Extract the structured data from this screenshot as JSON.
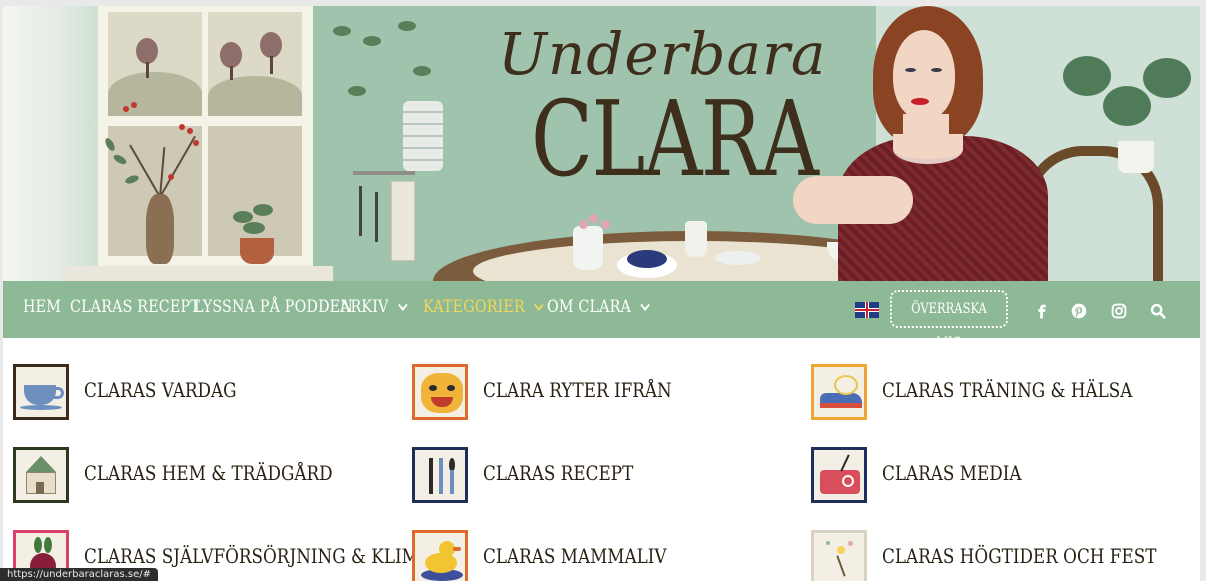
{
  "header": {
    "logo_script": "Underbara",
    "logo_main": "CLARA"
  },
  "nav": {
    "items": [
      {
        "label": "HEM"
      },
      {
        "label": "CLARAS RECEPT"
      },
      {
        "label": "LYSSNA PÅ PODDEN"
      },
      {
        "label": "ARKIV"
      },
      {
        "label": "KATEGORIER"
      },
      {
        "label": "OM CLARA"
      }
    ],
    "surprise_label": "ÖVERRASKA MIG",
    "language_flag": "uk-flag-icon",
    "social_icons": [
      "facebook-icon",
      "pinterest-icon",
      "instagram-icon",
      "search-icon"
    ],
    "active_color": "#f4d65a",
    "bar_color": "#8db997"
  },
  "categories": [
    {
      "label": "CLARAS VARDAG",
      "icon": "teacup-icon",
      "border": "#3b2a1a"
    },
    {
      "label": "CLARA RYTER IFRÅN",
      "icon": "tiger-icon",
      "border": "#e06a2a"
    },
    {
      "label": "CLARAS TRÄNING & HÄLSA",
      "icon": "sneaker-icon",
      "border": "#f0a530"
    },
    {
      "label": "CLARAS HEM & TRÄDGÅRD",
      "icon": "house-icon",
      "border": "#2c3a1e"
    },
    {
      "label": "CLARAS RECEPT",
      "icon": "cutlery-icon",
      "border": "#1f2f5a"
    },
    {
      "label": "CLARAS MEDIA",
      "icon": "radio-icon",
      "border": "#1f2f5a"
    },
    {
      "label": "CLARAS SJÄLVFÖRSÖRJNING & KLIMAT",
      "icon": "beetroot-icon",
      "border": "#d9416a"
    },
    {
      "label": "CLARAS MAMMALIV",
      "icon": "rubber-duck-icon",
      "border": "#e06a2a"
    },
    {
      "label": "CLARAS HÖGTIDER OCH FEST",
      "icon": "sparkler-icon",
      "border": "#d9d2c4"
    }
  ],
  "status_url": "https://underbaraclaras.se/#"
}
